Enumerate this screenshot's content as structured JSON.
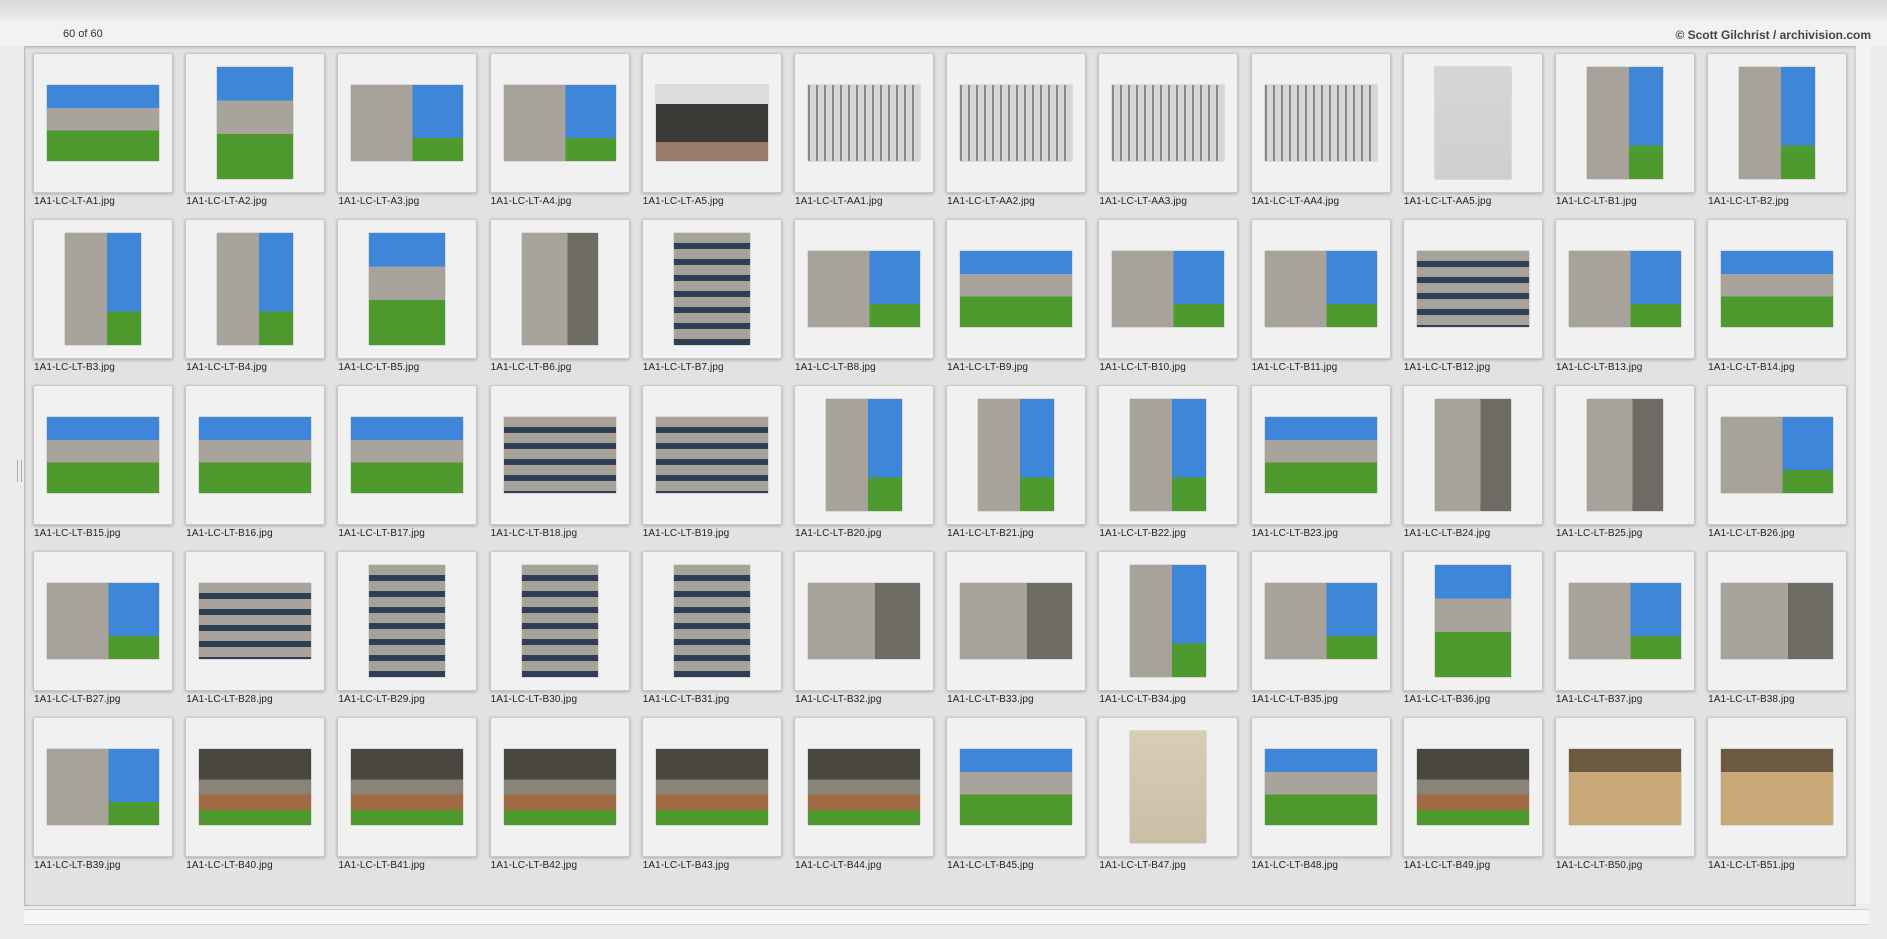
{
  "header": {
    "count": "60 of 60",
    "credit": "© Scott Gilchrist / archivision.com"
  },
  "palette": {
    "sky": "#3d86d8",
    "grass": "#4f9a2f",
    "concrete": "#a7a39a",
    "paper": "#d6d6d6",
    "window": "#2f3f55",
    "earth": "#a06a42"
  },
  "thumbnails": [
    {
      "filename": "1A1-LC-LT-A1.jpg",
      "orientation": "landscape",
      "scene": "grass-building"
    },
    {
      "filename": "1A1-LC-LT-A2.jpg",
      "orientation": "portrait",
      "scene": "grass-building"
    },
    {
      "filename": "1A1-LC-LT-A3.jpg",
      "orientation": "landscape",
      "scene": "sky-building"
    },
    {
      "filename": "1A1-LC-LT-A4.jpg",
      "orientation": "landscape",
      "scene": "sky-building"
    },
    {
      "filename": "1A1-LC-LT-A5.jpg",
      "orientation": "landscape",
      "scene": "dark-building"
    },
    {
      "filename": "1A1-LC-LT-AA1.jpg",
      "orientation": "landscape",
      "scene": "drawing"
    },
    {
      "filename": "1A1-LC-LT-AA2.jpg",
      "orientation": "landscape",
      "scene": "drawing"
    },
    {
      "filename": "1A1-LC-LT-AA3.jpg",
      "orientation": "landscape",
      "scene": "drawing"
    },
    {
      "filename": "1A1-LC-LT-AA4.jpg",
      "orientation": "landscape",
      "scene": "drawing"
    },
    {
      "filename": "1A1-LC-LT-AA5.jpg",
      "orientation": "portrait",
      "scene": "plan"
    },
    {
      "filename": "1A1-LC-LT-B1.jpg",
      "orientation": "portrait",
      "scene": "sky-building"
    },
    {
      "filename": "1A1-LC-LT-B2.jpg",
      "orientation": "portrait",
      "scene": "sky-building"
    },
    {
      "filename": "1A1-LC-LT-B3.jpg",
      "orientation": "portrait",
      "scene": "sky-building"
    },
    {
      "filename": "1A1-LC-LT-B4.jpg",
      "orientation": "portrait",
      "scene": "sky-building"
    },
    {
      "filename": "1A1-LC-LT-B5.jpg",
      "orientation": "portrait",
      "scene": "grass-building"
    },
    {
      "filename": "1A1-LC-LT-B6.jpg",
      "orientation": "portrait",
      "scene": "concrete"
    },
    {
      "filename": "1A1-LC-LT-B7.jpg",
      "orientation": "portrait",
      "scene": "facade"
    },
    {
      "filename": "1A1-LC-LT-B8.jpg",
      "orientation": "landscape",
      "scene": "sky-building"
    },
    {
      "filename": "1A1-LC-LT-B9.jpg",
      "orientation": "landscape",
      "scene": "grass-building"
    },
    {
      "filename": "1A1-LC-LT-B10.jpg",
      "orientation": "landscape",
      "scene": "sky-building"
    },
    {
      "filename": "1A1-LC-LT-B11.jpg",
      "orientation": "landscape",
      "scene": "sky-building"
    },
    {
      "filename": "1A1-LC-LT-B12.jpg",
      "orientation": "landscape",
      "scene": "facade"
    },
    {
      "filename": "1A1-LC-LT-B13.jpg",
      "orientation": "landscape",
      "scene": "sky-building"
    },
    {
      "filename": "1A1-LC-LT-B14.jpg",
      "orientation": "landscape",
      "scene": "grass-building"
    },
    {
      "filename": "1A1-LC-LT-B15.jpg",
      "orientation": "landscape",
      "scene": "grass-building"
    },
    {
      "filename": "1A1-LC-LT-B16.jpg",
      "orientation": "landscape",
      "scene": "grass-building"
    },
    {
      "filename": "1A1-LC-LT-B17.jpg",
      "orientation": "landscape",
      "scene": "grass-building"
    },
    {
      "filename": "1A1-LC-LT-B18.jpg",
      "orientation": "landscape",
      "scene": "facade"
    },
    {
      "filename": "1A1-LC-LT-B19.jpg",
      "orientation": "landscape",
      "scene": "facade"
    },
    {
      "filename": "1A1-LC-LT-B20.jpg",
      "orientation": "portrait",
      "scene": "sky-building"
    },
    {
      "filename": "1A1-LC-LT-B21.jpg",
      "orientation": "portrait",
      "scene": "sky-building"
    },
    {
      "filename": "1A1-LC-LT-B22.jpg",
      "orientation": "portrait",
      "scene": "sky-building"
    },
    {
      "filename": "1A1-LC-LT-B23.jpg",
      "orientation": "landscape",
      "scene": "grass-building"
    },
    {
      "filename": "1A1-LC-LT-B24.jpg",
      "orientation": "portrait",
      "scene": "concrete"
    },
    {
      "filename": "1A1-LC-LT-B25.jpg",
      "orientation": "portrait",
      "scene": "concrete"
    },
    {
      "filename": "1A1-LC-LT-B26.jpg",
      "orientation": "landscape",
      "scene": "sky-building"
    },
    {
      "filename": "1A1-LC-LT-B27.jpg",
      "orientation": "landscape",
      "scene": "sky-building"
    },
    {
      "filename": "1A1-LC-LT-B28.jpg",
      "orientation": "landscape",
      "scene": "facade"
    },
    {
      "filename": "1A1-LC-LT-B29.jpg",
      "orientation": "portrait",
      "scene": "facade"
    },
    {
      "filename": "1A1-LC-LT-B30.jpg",
      "orientation": "portrait",
      "scene": "facade"
    },
    {
      "filename": "1A1-LC-LT-B31.jpg",
      "orientation": "portrait",
      "scene": "facade"
    },
    {
      "filename": "1A1-LC-LT-B32.jpg",
      "orientation": "landscape",
      "scene": "concrete"
    },
    {
      "filename": "1A1-LC-LT-B33.jpg",
      "orientation": "landscape",
      "scene": "concrete"
    },
    {
      "filename": "1A1-LC-LT-B34.jpg",
      "orientation": "portrait",
      "scene": "sky-building"
    },
    {
      "filename": "1A1-LC-LT-B35.jpg",
      "orientation": "landscape",
      "scene": "sky-building"
    },
    {
      "filename": "1A1-LC-LT-B36.jpg",
      "orientation": "portrait",
      "scene": "grass-building"
    },
    {
      "filename": "1A1-LC-LT-B37.jpg",
      "orientation": "landscape",
      "scene": "sky-building"
    },
    {
      "filename": "1A1-LC-LT-B38.jpg",
      "orientation": "landscape",
      "scene": "concrete"
    },
    {
      "filename": "1A1-LC-LT-B39.jpg",
      "orientation": "landscape",
      "scene": "sky-building"
    },
    {
      "filename": "1A1-LC-LT-B40.jpg",
      "orientation": "landscape",
      "scene": "underside"
    },
    {
      "filename": "1A1-LC-LT-B41.jpg",
      "orientation": "landscape",
      "scene": "underside"
    },
    {
      "filename": "1A1-LC-LT-B42.jpg",
      "orientation": "landscape",
      "scene": "underside"
    },
    {
      "filename": "1A1-LC-LT-B43.jpg",
      "orientation": "landscape",
      "scene": "underside"
    },
    {
      "filename": "1A1-LC-LT-B44.jpg",
      "orientation": "landscape",
      "scene": "underside"
    },
    {
      "filename": "1A1-LC-LT-B45.jpg",
      "orientation": "landscape",
      "scene": "grass-building"
    },
    {
      "filename": "1A1-LC-LT-B47.jpg",
      "orientation": "portrait",
      "scene": "wall"
    },
    {
      "filename": "1A1-LC-LT-B48.jpg",
      "orientation": "landscape",
      "scene": "grass-building"
    },
    {
      "filename": "1A1-LC-LT-B49.jpg",
      "orientation": "landscape",
      "scene": "underside"
    },
    {
      "filename": "1A1-LC-LT-B50.jpg",
      "orientation": "landscape",
      "scene": "interior"
    },
    {
      "filename": "1A1-LC-LT-B51.jpg",
      "orientation": "landscape",
      "scene": "interior"
    }
  ]
}
